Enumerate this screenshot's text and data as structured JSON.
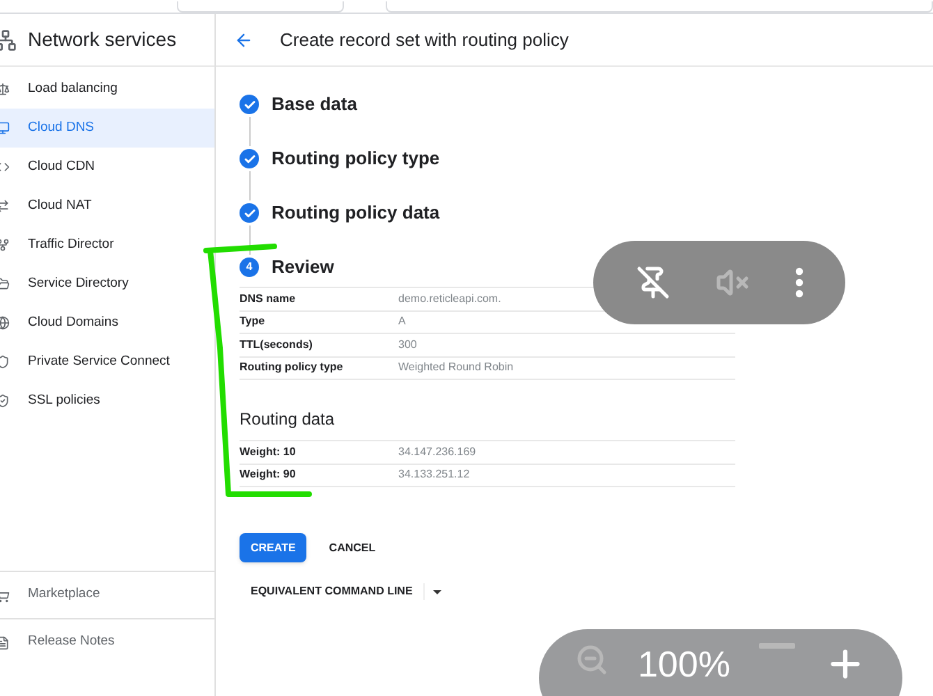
{
  "sidebar": {
    "title": "Network services",
    "items": [
      {
        "label": "Load balancing",
        "selected": false
      },
      {
        "label": "Cloud DNS",
        "selected": true
      },
      {
        "label": "Cloud CDN",
        "selected": false
      },
      {
        "label": "Cloud NAT",
        "selected": false
      },
      {
        "label": "Traffic Director",
        "selected": false
      },
      {
        "label": "Service Directory",
        "selected": false
      },
      {
        "label": "Cloud Domains",
        "selected": false
      },
      {
        "label": "Private Service Connect",
        "selected": false
      },
      {
        "label": "SSL policies",
        "selected": false
      }
    ],
    "footer_items": [
      {
        "label": "Marketplace"
      },
      {
        "label": "Release Notes"
      }
    ]
  },
  "header": {
    "title": "Create record set with routing policy"
  },
  "steps": [
    {
      "label": "Base data",
      "kind": "done"
    },
    {
      "label": "Routing policy type",
      "kind": "done"
    },
    {
      "label": "Routing policy data",
      "kind": "done"
    },
    {
      "label": "Review",
      "kind": "current",
      "number": "4"
    }
  ],
  "review_rows": [
    {
      "label": "DNS name",
      "value": "demo.reticleapi.com."
    },
    {
      "label": "Type",
      "value": "A"
    },
    {
      "label": "TTL(seconds)",
      "value": "300"
    },
    {
      "label": "Routing policy type",
      "value": "Weighted Round Robin"
    }
  ],
  "routing_data": {
    "title": "Routing data",
    "rows": [
      {
        "label": "Weight: 10",
        "value": "34.147.236.169"
      },
      {
        "label": "Weight: 90",
        "value": "34.133.251.12"
      }
    ]
  },
  "buttons": {
    "create": "CREATE",
    "cancel": "CANCEL",
    "command_line": "EQUIVALENT COMMAND LINE"
  },
  "video_controls": [
    {
      "kind": "pin-off",
      "disabled": false
    },
    {
      "kind": "mute",
      "disabled": true
    },
    {
      "kind": "more",
      "disabled": false
    }
  ],
  "zoom_controls": {
    "value": "100%",
    "buttons": [
      {
        "kind": "zoom-out",
        "disabled": true
      },
      {
        "kind": "minus",
        "disabled": true
      },
      {
        "kind": "plus",
        "disabled": false
      }
    ]
  }
}
